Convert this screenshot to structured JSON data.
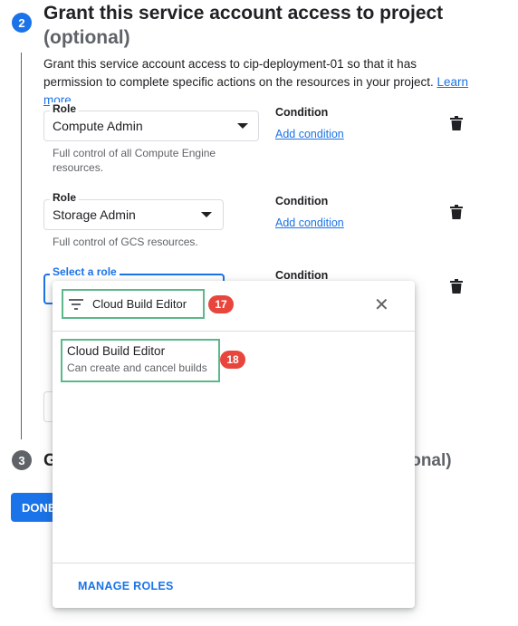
{
  "step2": {
    "number": "2",
    "title": "Grant this service account access to project",
    "optional": "(optional)",
    "description": "Grant this service account access to cip-deployment-01 so that it has permission to complete specific actions on the resources in your project.",
    "learn_more": "Learn more"
  },
  "roles": [
    {
      "label": "Role",
      "value": "Compute Admin",
      "helper": "Full control of all Compute Engine resources.",
      "condition_title": "Condition",
      "condition_link": "Add condition"
    },
    {
      "label": "Role",
      "value": "Storage Admin",
      "helper": "Full control of GCS resources.",
      "condition_title": "Condition",
      "condition_link": "Add condition"
    },
    {
      "label": "Select a role",
      "value": "",
      "condition_title": "Condition"
    }
  ],
  "step3": {
    "number": "3",
    "title_start": "G",
    "title_end": "ptional)"
  },
  "done_button": "DONE",
  "dropdown": {
    "filter_text": "Cloud Build Editor",
    "option_title": "Cloud Build Editor",
    "option_subtitle": "Can create and cancel builds",
    "manage_roles": "MANAGE ROLES"
  },
  "badges": {
    "filter": "17",
    "option": "18"
  },
  "colors": {
    "accent": "#1a73e8",
    "highlight": "#5cb88a",
    "badge": "#e8453c"
  }
}
